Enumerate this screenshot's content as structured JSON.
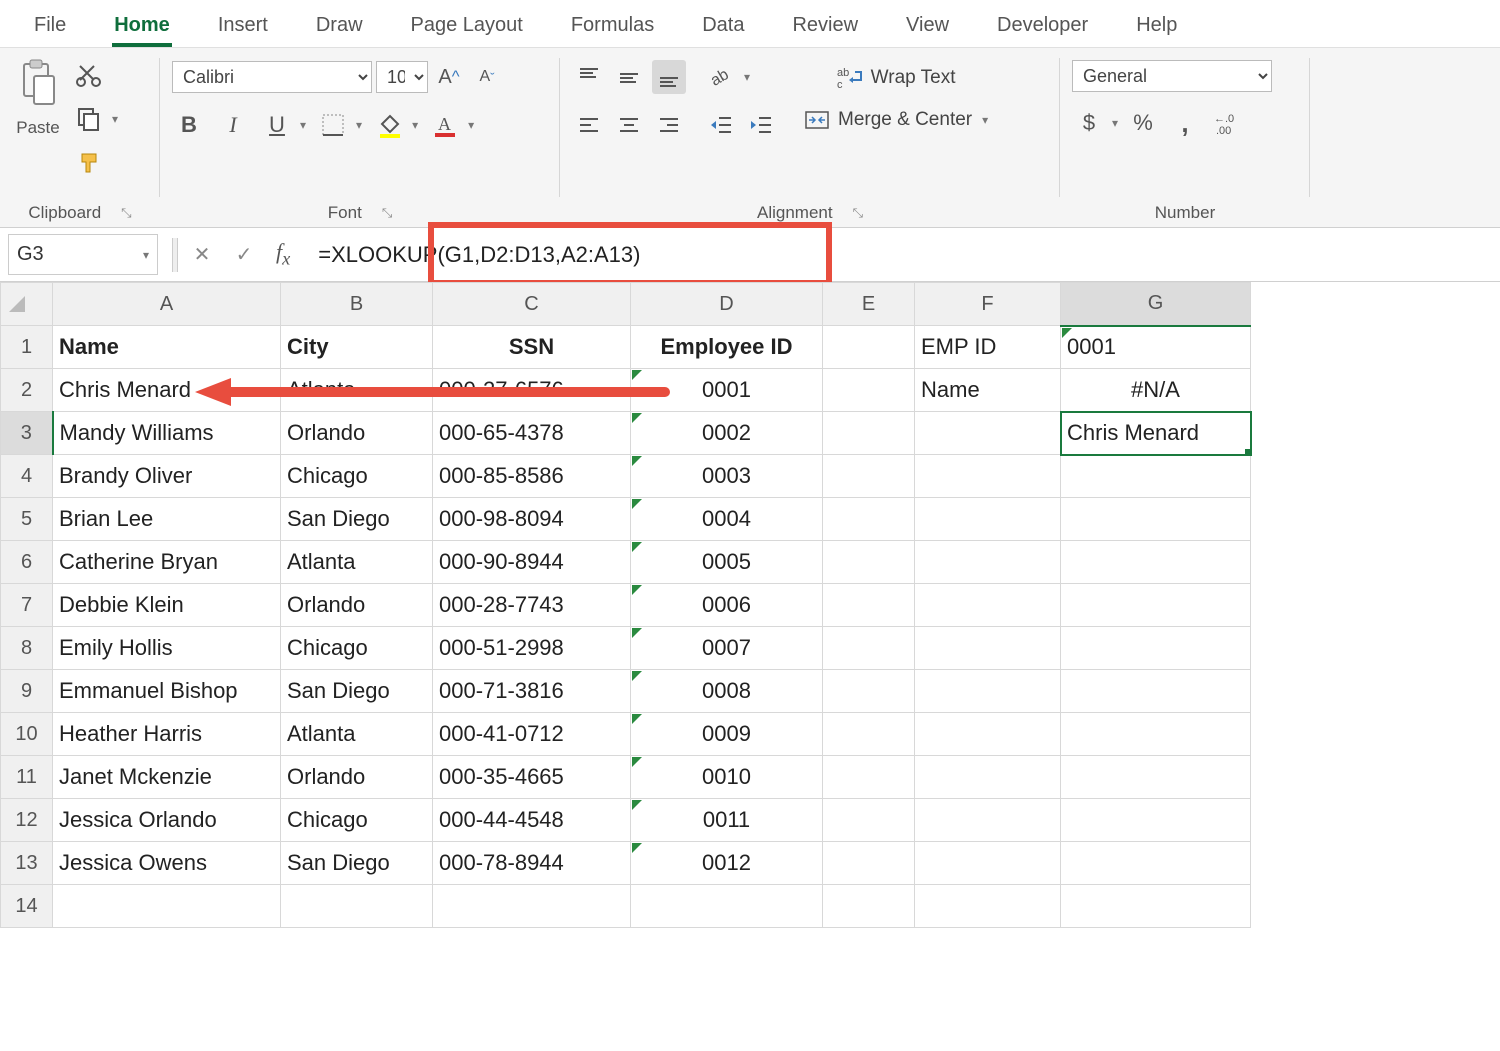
{
  "tabs": [
    "File",
    "Home",
    "Insert",
    "Draw",
    "Page Layout",
    "Formulas",
    "Data",
    "Review",
    "View",
    "Developer",
    "Help"
  ],
  "active_tab": "Home",
  "groups": {
    "clipboard": "Clipboard",
    "font": "Font",
    "alignment": "Alignment",
    "number": "Number"
  },
  "clipboard": {
    "paste": "Paste"
  },
  "font": {
    "name": "Calibri",
    "size": "10",
    "bold": "B",
    "italic": "I",
    "underline": "U"
  },
  "alignment": {
    "wrap": "Wrap Text",
    "merge": "Merge & Center"
  },
  "number": {
    "format": "General",
    "currency": "$",
    "percent": "%",
    "comma": ","
  },
  "name_box": "G3",
  "formula": "=XLOOKUP(G1,D2:D13,A2:A13)",
  "columns": [
    "A",
    "B",
    "C",
    "D",
    "E",
    "F",
    "G"
  ],
  "headers": {
    "A": "Name",
    "B": "City",
    "C": "SSN",
    "D": "Employee ID",
    "F1": "EMP ID",
    "F2": "Name",
    "G1": "0001",
    "G2": "#N/A",
    "G3": "Chris Menard"
  },
  "rows": [
    {
      "n": 1
    },
    {
      "n": 2,
      "A": "Chris Menard",
      "B": "Atlanta",
      "C": "000-27-6576",
      "D": "0001"
    },
    {
      "n": 3,
      "A": "Mandy Williams",
      "B": "Orlando",
      "C": "000-65-4378",
      "D": "0002"
    },
    {
      "n": 4,
      "A": "Brandy Oliver",
      "B": "Chicago",
      "C": "000-85-8586",
      "D": "0003"
    },
    {
      "n": 5,
      "A": "Brian Lee",
      "B": "San Diego",
      "C": "000-98-8094",
      "D": "0004"
    },
    {
      "n": 6,
      "A": "Catherine Bryan",
      "B": "Atlanta",
      "C": "000-90-8944",
      "D": "0005"
    },
    {
      "n": 7,
      "A": "Debbie Klein",
      "B": "Orlando",
      "C": "000-28-7743",
      "D": "0006"
    },
    {
      "n": 8,
      "A": "Emily Hollis",
      "B": "Chicago",
      "C": "000-51-2998",
      "D": "0007"
    },
    {
      "n": 9,
      "A": "Emmanuel Bishop",
      "B": "San Diego",
      "C": "000-71-3816",
      "D": "0008"
    },
    {
      "n": 10,
      "A": "Heather Harris",
      "B": "Atlanta",
      "C": "000-41-0712",
      "D": "0009"
    },
    {
      "n": 11,
      "A": "Janet Mckenzie",
      "B": "Orlando",
      "C": "000-35-4665",
      "D": "0010"
    },
    {
      "n": 12,
      "A": "Jessica Orlando",
      "B": "Chicago",
      "C": "000-44-4548",
      "D": "0011"
    },
    {
      "n": 13,
      "A": "Jessica Owens",
      "B": "San Diego",
      "C": "000-78-8944",
      "D": "0012"
    },
    {
      "n": 14
    }
  ]
}
